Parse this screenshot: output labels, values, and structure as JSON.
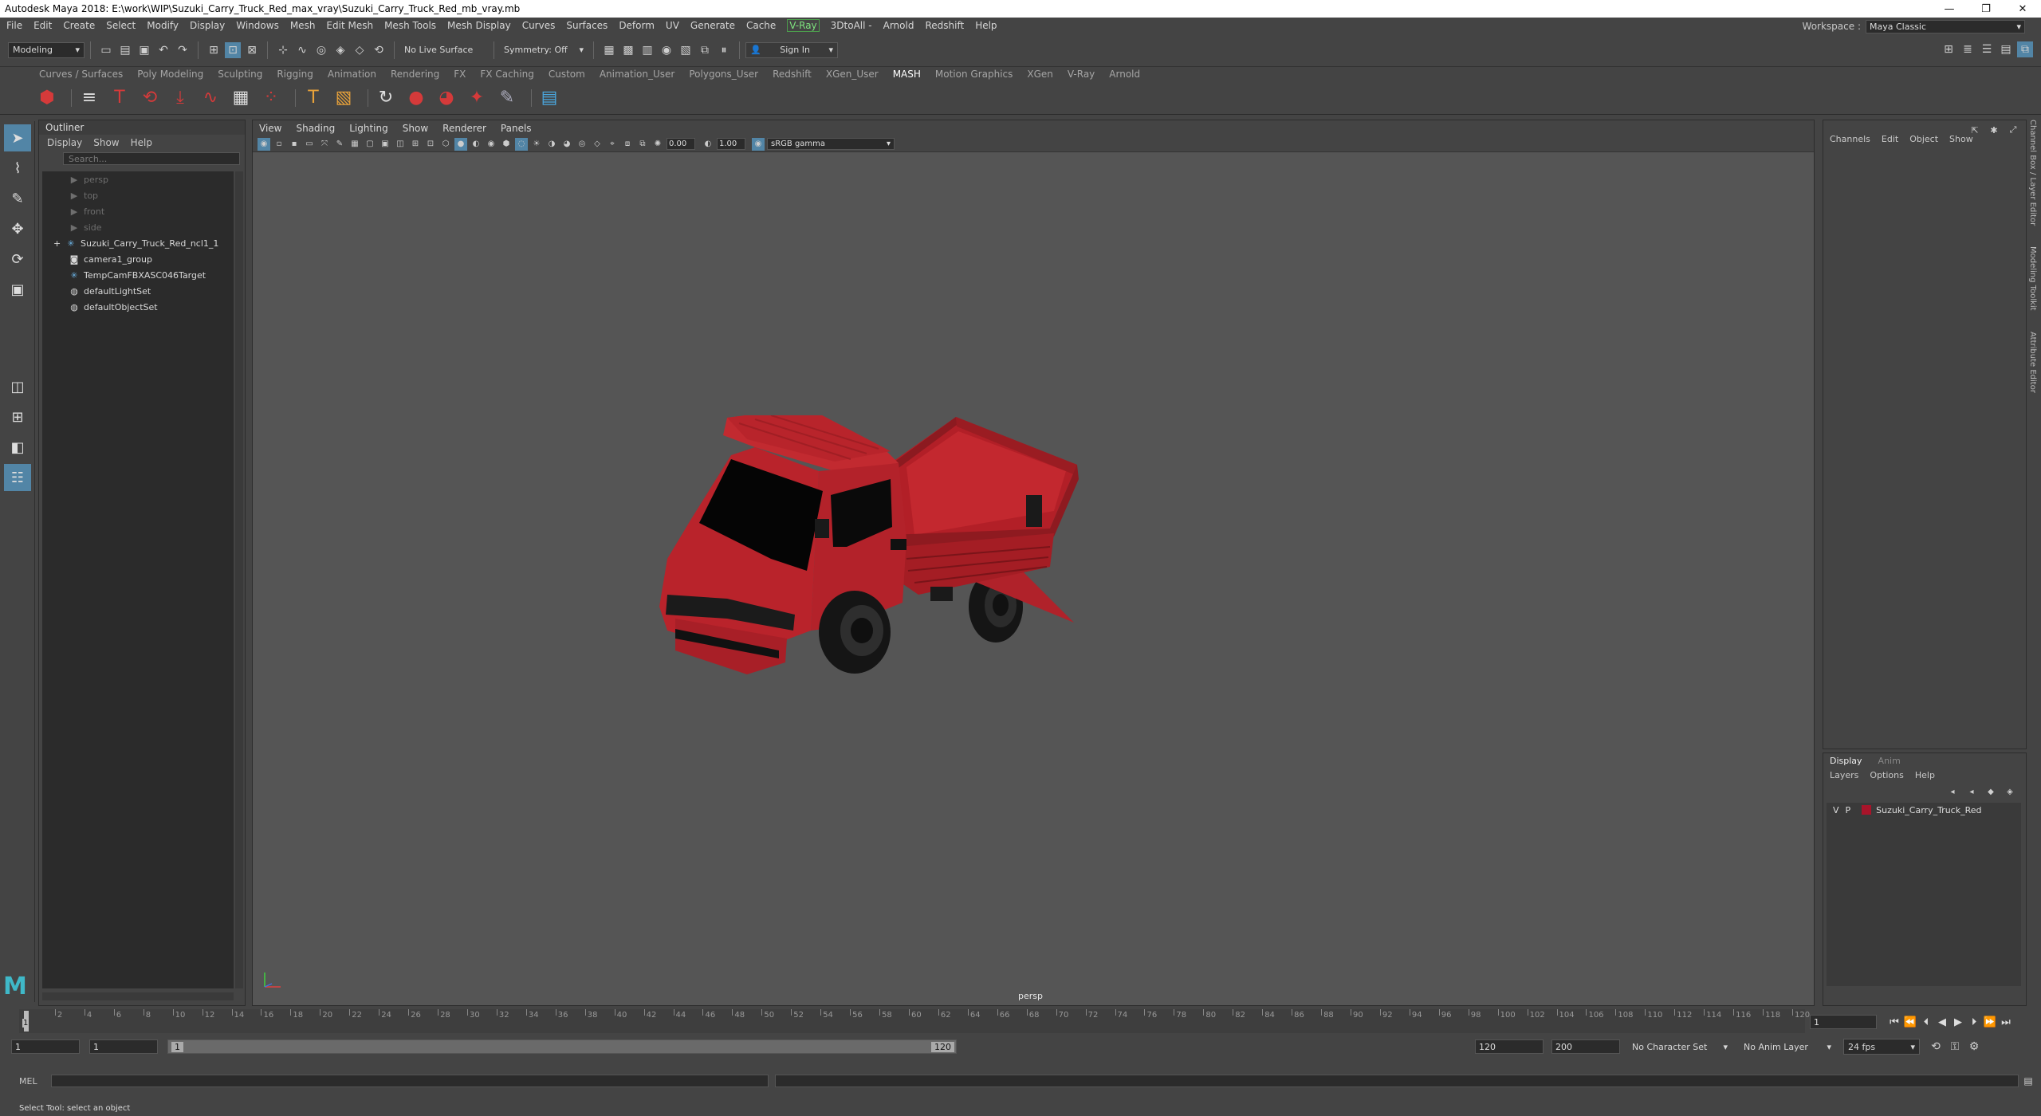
{
  "window": {
    "title": "Autodesk Maya 2018: E:\\work\\WIP\\Suzuki_Carry_Truck_Red_max_vray\\Suzuki_Carry_Truck_Red_mb_vray.mb",
    "minimize": "—",
    "restore": "❐",
    "close": "✕"
  },
  "menubar": {
    "items": [
      "File",
      "Edit",
      "Create",
      "Select",
      "Modify",
      "Display",
      "Windows",
      "Mesh",
      "Edit Mesh",
      "Mesh Tools",
      "Mesh Display",
      "Curves",
      "Surfaces",
      "Deform",
      "UV",
      "Generate",
      "Cache"
    ],
    "vray": "V-Ray",
    "items2": [
      "3DtoAll -",
      "Arnold",
      "Redshift",
      "Help"
    ]
  },
  "workspace": {
    "label": "Workspace :",
    "value": "Maya Classic"
  },
  "statusline": {
    "mode": "Modeling",
    "live_surface": "No Live Surface",
    "symmetry": "Symmetry: Off",
    "sign_in": "Sign In"
  },
  "shelf_tabs": [
    "Curves / Surfaces",
    "Poly Modeling",
    "Sculpting",
    "Rigging",
    "Animation",
    "Rendering",
    "FX",
    "FX Caching",
    "Custom",
    "Animation_User",
    "Polygons_User",
    "Redshift",
    "XGen_User",
    "MASH",
    "Motion Graphics",
    "XGen",
    "V-Ray",
    "Arnold"
  ],
  "shelf_active": "MASH",
  "outliner": {
    "title": "Outliner",
    "menus": [
      "Display",
      "Show",
      "Help"
    ],
    "search_placeholder": "Search...",
    "items": [
      {
        "label": "persp",
        "dim": true,
        "icon": "camera-icon"
      },
      {
        "label": "top",
        "dim": true,
        "icon": "camera-icon"
      },
      {
        "label": "front",
        "dim": true,
        "icon": "camera-icon"
      },
      {
        "label": "side",
        "dim": true,
        "icon": "camera-icon"
      },
      {
        "label": "Suzuki_Carry_Truck_Red_ncl1_1",
        "dim": false,
        "icon": "transform-icon",
        "expand": "+"
      },
      {
        "label": "camera1_group",
        "dim": false,
        "icon": "group-icon"
      },
      {
        "label": "TempCamFBXASC046Target",
        "dim": false,
        "icon": "transform-icon"
      },
      {
        "label": "defaultLightSet",
        "dim": false,
        "icon": "set-icon"
      },
      {
        "label": "defaultObjectSet",
        "dim": false,
        "icon": "set-icon"
      }
    ]
  },
  "viewport": {
    "menus": [
      "View",
      "Shading",
      "Lighting",
      "Show",
      "Renderer",
      "Panels"
    ],
    "exposure": "0.00",
    "gamma": "1.00",
    "colorspace": "sRGB gamma",
    "camera_label": "persp"
  },
  "channelbox": {
    "menus": [
      "Channels",
      "Edit",
      "Object",
      "Show"
    ]
  },
  "layer_editor": {
    "tabs": [
      "Display",
      "Anim"
    ],
    "menus": [
      "Layers",
      "Options",
      "Help"
    ],
    "layer": {
      "v": "V",
      "p": "P",
      "name": "Suzuki_Carry_Truck_Red",
      "color": "#a8142a"
    }
  },
  "side_tabs": [
    "Channel Box / Layer Editor",
    "Modeling Toolkit",
    "Attribute Editor"
  ],
  "timeslider": {
    "ticks": [
      "2",
      "4",
      "6",
      "8",
      "10",
      "12",
      "14",
      "16",
      "18",
      "20",
      "22",
      "24",
      "26",
      "28",
      "30",
      "32",
      "34",
      "36",
      "38",
      "40",
      "42",
      "44",
      "46",
      "48",
      "50",
      "52",
      "54",
      "56",
      "58",
      "60",
      "62",
      "64",
      "66",
      "68",
      "70",
      "72",
      "74",
      "76",
      "78",
      "80",
      "82",
      "84",
      "86",
      "88",
      "90",
      "92",
      "94",
      "96",
      "98",
      "100",
      "102",
      "104",
      "106",
      "108",
      "110",
      "112",
      "114",
      "116",
      "118",
      "120"
    ],
    "current": "1",
    "current_field": "1"
  },
  "range": {
    "start": "1",
    "playback_start": "1",
    "bar_start": "1",
    "bar_end": "120",
    "playback_end": "120",
    "end": "200",
    "character_set": "No Character Set",
    "anim_layer": "No Anim Layer",
    "fps": "24 fps"
  },
  "cmdline": {
    "label": "MEL"
  },
  "helpline": {
    "text": "Select Tool: select an object"
  },
  "colors": {
    "accent": "#5285a6",
    "truck_red": "#b5202a",
    "viewport_bg": "#555555"
  }
}
